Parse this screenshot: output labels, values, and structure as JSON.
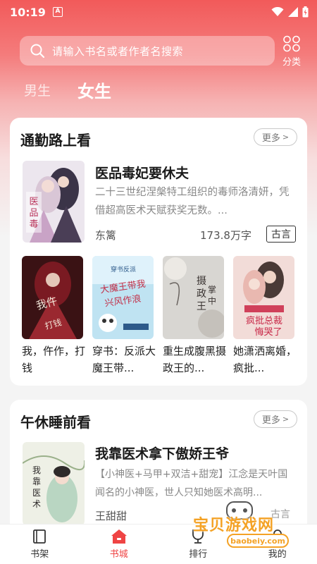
{
  "status_bar": {
    "time": "10:19",
    "app_badge": "A"
  },
  "search": {
    "placeholder": "请输入书名或者作者名搜索"
  },
  "category": {
    "label": "分类"
  },
  "gender_tabs": [
    {
      "label": "男生",
      "active": false
    },
    {
      "label": "女生",
      "active": true
    }
  ],
  "sections": [
    {
      "title": "通勤路上看",
      "more_label": "更多",
      "featured": {
        "title": "医品毒妃要休夫",
        "description": "二十三世纪涅槃特工组织的毒师洛清妍，凭借超高医术天赋获奖无数。...",
        "author": "东篱",
        "word_count": "173.8万字",
        "tag": "古言",
        "cover_text": "医品毒妃要休夫"
      },
      "grid": [
        {
          "title": "我，仵作，打钱",
          "cover_text": "我仵作打钱"
        },
        {
          "title": "穿书：反派大魔王带...",
          "cover_text": "穿书反派 大魔王带我兴风作浪"
        },
        {
          "title": "重生成腹黑摄政王的...",
          "cover_text": "摄政王的掌中娇"
        },
        {
          "title": "她潇洒离婚，疯批...",
          "cover_text": "疯批总裁悔哭了"
        }
      ]
    },
    {
      "title": "午休睡前看",
      "more_label": "更多",
      "featured": {
        "title": "我靠医术拿下傲娇王爷",
        "description": "【小神医+马甲+双洁+甜宠】江念是天叶国闻名的小神医，世人只知她医术高明...",
        "author": "王甜甜",
        "tag": "古言",
        "cover_text": "我靠医术拿下傲娇王爷"
      }
    }
  ],
  "tab_bar": [
    {
      "label": "书架",
      "icon": "bookshelf-icon",
      "active": false
    },
    {
      "label": "书城",
      "icon": "home-icon",
      "active": true
    },
    {
      "label": "排行",
      "icon": "ranking-icon",
      "active": false
    },
    {
      "label": "我的",
      "icon": "profile-icon",
      "active": false
    }
  ],
  "watermark": {
    "text": "宝贝游戏网",
    "url": "baobeiy.com"
  },
  "colors": {
    "accent": "#ef4444",
    "header_top": "#f25a5a"
  }
}
